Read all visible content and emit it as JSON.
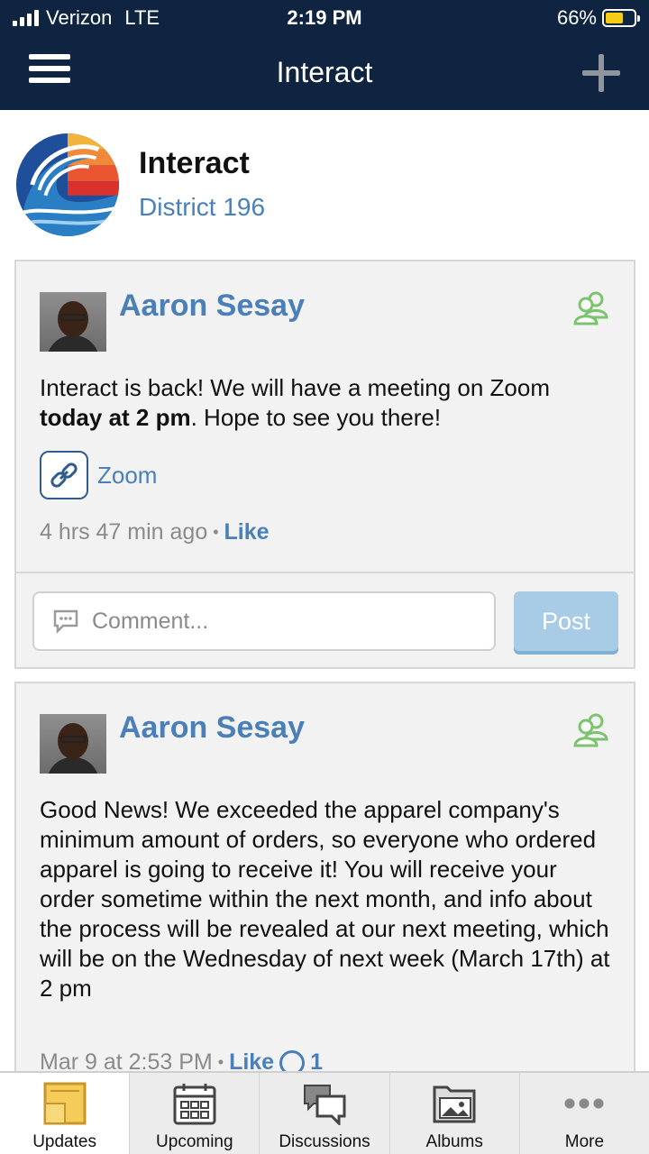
{
  "status_bar": {
    "carrier": "Verizon",
    "network": "LTE",
    "time": "2:19 PM",
    "battery": "66%"
  },
  "nav": {
    "title": "Interact"
  },
  "group": {
    "name": "Interact",
    "subtitle": "District 196"
  },
  "posts": [
    {
      "author": "Aaron Sesay",
      "text_before": "Interact is back! We will have a meeting on Zoom ",
      "text_bold": "today at 2 pm",
      "text_after": ". Hope to see you there!",
      "link_label": "Zoom",
      "time": "4 hrs 47 min ago",
      "like_label": "Like",
      "comment_placeholder": "Comment...",
      "post_button": "Post"
    },
    {
      "author": "Aaron Sesay",
      "text": "Good News! We exceeded the apparel company's minimum amount of orders, so everyone who ordered apparel is going to receive it! You will receive your order sometime within the next month, and info about the process will be revealed at our next meeting, which will be on the Wednesday of next week (March 17th) at 2 pm",
      "time": "Mar 9 at 2:53 PM",
      "like_label": "Like",
      "reaction_count": "1"
    }
  ],
  "tabs": [
    {
      "label": "Updates",
      "icon": "updates-icon",
      "active": true
    },
    {
      "label": "Upcoming",
      "icon": "calendar-icon"
    },
    {
      "label": "Discussions",
      "icon": "discussions-icon"
    },
    {
      "label": "Albums",
      "icon": "albums-icon"
    },
    {
      "label": "More",
      "icon": "more-icon"
    }
  ],
  "colors": {
    "nav_bg": "#0e2440",
    "link_blue": "#4a7fb8",
    "post_button": "#a8cbe6",
    "members_green": "#7cc36e"
  }
}
